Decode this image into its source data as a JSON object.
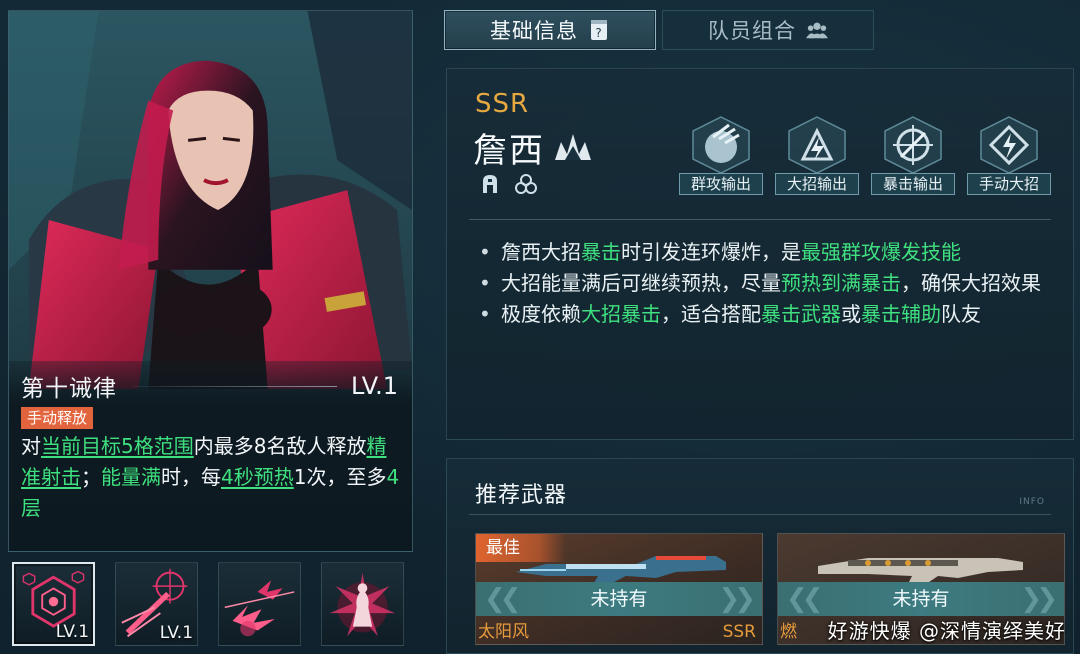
{
  "tabs": [
    {
      "label": "基础信息",
      "icon": "info-card-icon",
      "active": true
    },
    {
      "label": "队员组合",
      "icon": "team-icon",
      "active": false
    }
  ],
  "skill": {
    "name": "第十诫律",
    "level": "LV.1",
    "tag": "手动释放",
    "desc": {
      "p1": "对",
      "h1": "当前目标5格范围",
      "p2": "内最多8名敌人释放",
      "h2": "精准射击",
      "p3": "；",
      "h3": "能量满",
      "p4": "时，每",
      "h4": "4秒预热",
      "p5": "1次，至多",
      "h5": "4层"
    },
    "slots": [
      {
        "icon": "hexagon-target-icon",
        "level": "LV.1",
        "selected": true
      },
      {
        "icon": "crosshair-shot-icon",
        "level": "LV.1",
        "selected": false
      },
      {
        "icon": "burst-explosion-icon",
        "level": "",
        "selected": false
      },
      {
        "icon": "character-burst-icon",
        "level": "",
        "selected": false
      }
    ]
  },
  "character": {
    "rarity": "SSR",
    "name": "詹西",
    "roles": [
      "群攻输出",
      "大招输出",
      "暴击输出",
      "手动大招"
    ],
    "bullets": {
      "b1": {
        "p1": "詹西大招",
        "h1": "暴击",
        "p2": "时引发连环爆炸，是",
        "h2": "最强群攻爆发技能"
      },
      "b2": {
        "p1": "大招能量满后可继续预热，尽量",
        "h1": "预热到满暴击",
        "p2": "，确保大招效果"
      },
      "b3": {
        "p1": "极度依赖",
        "h1": "大招暴击",
        "p2": "，适合搭配",
        "h2": "暴击武器",
        "p3": "或",
        "h3": "暴击辅助",
        "p4": "队友"
      }
    }
  },
  "weapons": {
    "title": "推荐武器",
    "info": "INFO",
    "items": [
      {
        "best_label": "最佳",
        "status": "未持有",
        "name": "太阳风",
        "rarity": "SSR"
      },
      {
        "best_label": "",
        "status": "未持有",
        "name": "燃",
        "rarity": ""
      }
    ]
  },
  "watermark": "好游快爆 @深情演绎美好",
  "colors": {
    "highlight": "#3fe07f",
    "rarity": "#e7a840",
    "tag": "#e2643d"
  }
}
